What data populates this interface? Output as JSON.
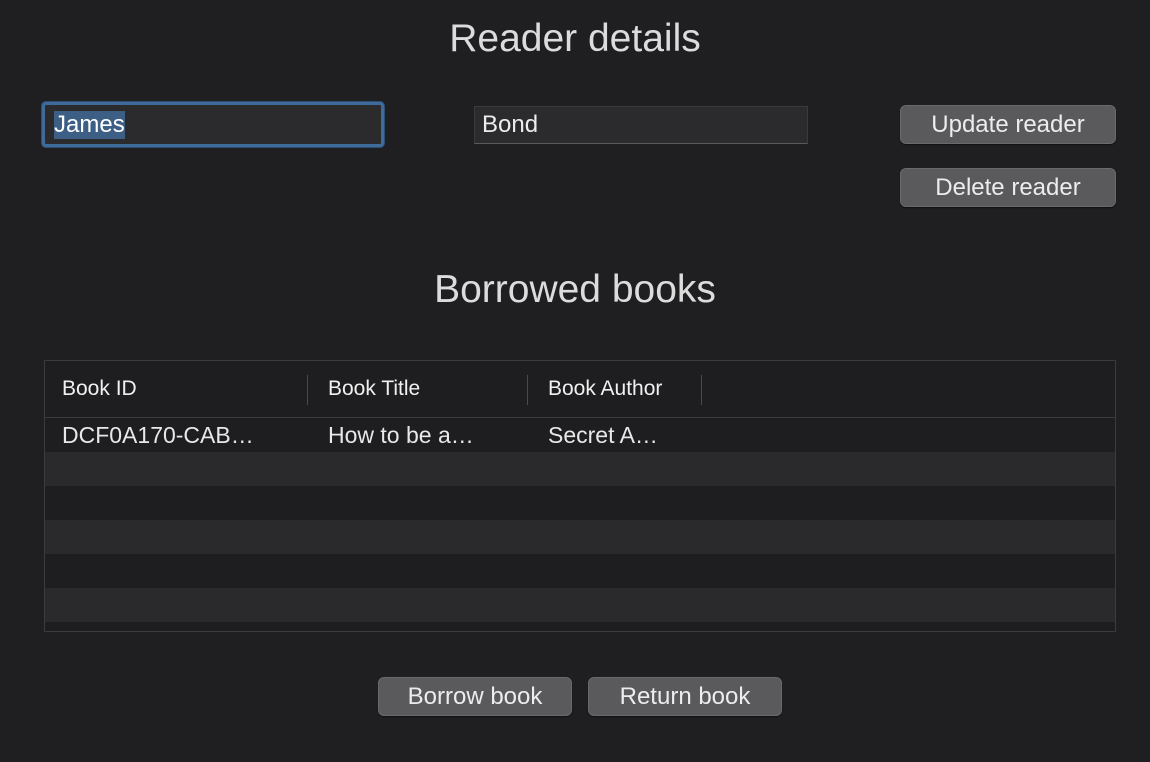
{
  "reader_section": {
    "title": "Reader details",
    "first_name": "James",
    "last_name": "Bond",
    "update_label": "Update reader",
    "delete_label": "Delete reader"
  },
  "borrowed_section": {
    "title": "Borrowed books",
    "columns": [
      "Book ID",
      "Book Title",
      "Book Author"
    ],
    "rows": [
      [
        "DCF0A170-CAB…",
        "How to be a…",
        "Secret A…"
      ]
    ],
    "borrow_label": "Borrow book",
    "return_label": "Return book"
  },
  "colors": {
    "background": "#1f1f21",
    "focus_ring": "#3f6b9a",
    "button": "#5a5a5d"
  }
}
